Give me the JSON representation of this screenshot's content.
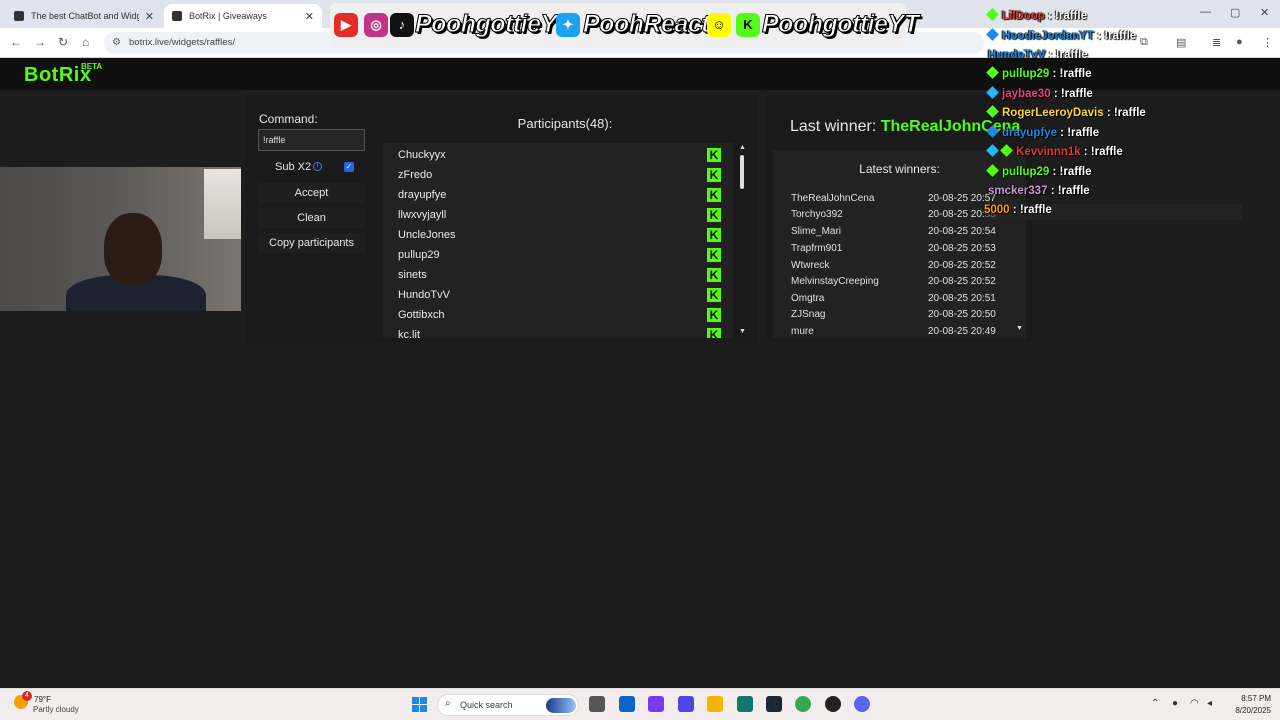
{
  "browser": {
    "tabs": [
      {
        "label": "The best ChatBot and Widgets",
        "close": "✕"
      },
      {
        "label": "BotRix | Giveaways",
        "close": "✕"
      }
    ],
    "url": "botrix.live/widgets/raffles/",
    "window_controls": [
      "—",
      "▢",
      "✕"
    ]
  },
  "app": {
    "logo": "BotRix",
    "beta": "BETA",
    "brand_color": "#53fc18"
  },
  "controls": {
    "command_label": "Command:",
    "command_value": "!raffle",
    "sub_label": "Sub X2",
    "sub_checked": true,
    "accept": "Accept",
    "clean": "Clean",
    "copy": "Copy participants"
  },
  "participants": {
    "title": "Participants(48):",
    "platform_icon": "kick-icon",
    "items": [
      "Chuckyyx",
      "zFredo",
      "drayupfye",
      "llwxvyjayll",
      "UncleJones",
      "pullup29",
      "sinets",
      "HundoTvV",
      "Gottibxch",
      "kc.lit"
    ]
  },
  "winners": {
    "last_label": "Last winner:",
    "last_name": "TheRealJohnCena",
    "latest_title": "Latest winners:",
    "items": [
      {
        "name": "TheRealJohnCena",
        "time": "20-08-25 20:57"
      },
      {
        "name": "Torchyo392",
        "time": "20-08-25 20:55"
      },
      {
        "name": "Slime_Mari",
        "time": "20-08-25 20:54"
      },
      {
        "name": "Trapfrm901",
        "time": "20-08-25 20:53"
      },
      {
        "name": "Wtwreck",
        "time": "20-08-25 20:52"
      },
      {
        "name": "MelvinstayCreeping",
        "time": "20-08-25 20:52"
      },
      {
        "name": "Omgtra",
        "time": "20-08-25 20:51"
      },
      {
        "name": "ZJSnag",
        "time": "20-08-25 20:50"
      },
      {
        "name": "mure",
        "time": "20-08-25 20:49"
      }
    ]
  },
  "banner": {
    "handle1": "PoohgottieYT",
    "handle2": "PoohReacts",
    "handle3": "PoohgottieYT"
  },
  "chat": [
    {
      "user": "LilDoop",
      "color": "#e53935",
      "message": ": !raffle"
    },
    {
      "user": "HoodieJordanYT",
      "color": "#1e88e5",
      "message": ": !raffle"
    },
    {
      "user": "HundoTvV",
      "color": "#1e88e5",
      "message": ": !raffle"
    },
    {
      "user": "pullup29",
      "color": "#53fc18",
      "message": ": !raffle"
    },
    {
      "user": "jaybae30",
      "color": "#ec407a",
      "message": ": !raffle"
    },
    {
      "user": "RogerLeeroyDavis",
      "color": "#fdd835",
      "message": ": !raffle"
    },
    {
      "user": "drayupfye",
      "color": "#1e88e5",
      "message": ": !raffle"
    },
    {
      "user": "Kevvinnn1k",
      "color": "#e53935",
      "message": ": !raffle"
    },
    {
      "user": "pullup29",
      "color": "#53fc18",
      "message": ": !raffle"
    },
    {
      "user": "smcker337",
      "color": "#ce93d8",
      "message": ": !raffle"
    },
    {
      "user": "5000",
      "color": "#ff9800",
      "message": ": !raffle"
    }
  ],
  "taskbar": {
    "weather_temp": "79°F",
    "weather_desc": "Partly cloudy",
    "weather_badge": "4",
    "search_label": "Quick search",
    "time": "8:57 PM",
    "date": "8/20/2025"
  }
}
